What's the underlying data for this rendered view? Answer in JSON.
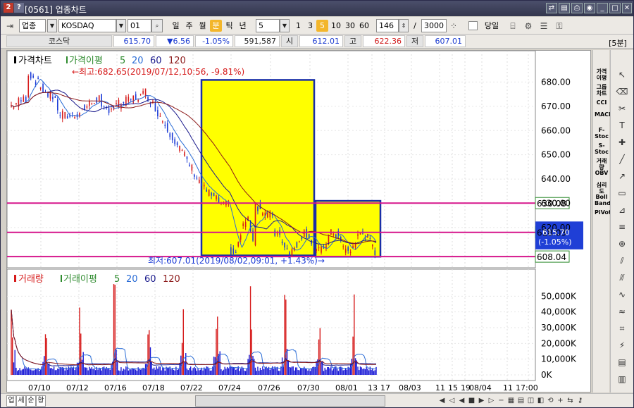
{
  "window": {
    "title": "[0561] 업종차트",
    "icons": [
      "2",
      "?"
    ]
  },
  "toolbar": {
    "type_select": "업종",
    "symbol_input": "KOSDAQ",
    "code_input": "01",
    "periods": [
      "일",
      "주",
      "월",
      "분",
      "틱",
      "년"
    ],
    "active_period": "분",
    "interval_value": "5",
    "interval_buttons": [
      "1",
      "3",
      "5",
      "10",
      "30",
      "60"
    ],
    "active_interval": "5",
    "count_value": "146",
    "slash": "/",
    "total_value": "3000",
    "same_day_label": "당일",
    "badge": "[5분]"
  },
  "quote": {
    "name": "코스닥",
    "price": "615.70",
    "change": "▼6.56",
    "change_pct": "-1.05%",
    "volume": "591,587",
    "open_label": "시",
    "open": "612.01",
    "high_label": "고",
    "high": "622.36",
    "low_label": "저",
    "low": "607.01"
  },
  "price_panel": {
    "legend_title": "가격차트",
    "legend_ma_title": "가격이평",
    "legend_periods": [
      "5",
      "20",
      "60",
      "120"
    ],
    "legend_colors": [
      "#2e8b2e",
      "#2a6cd6",
      "#1a1a8c",
      "#8c1a1a"
    ],
    "y_ticks": [
      "680.00",
      "670.00",
      "660.00",
      "650.00",
      "640.00",
      "630.00",
      "620.00"
    ],
    "high_note": "←최고:682.65(2019/07/12,10:56, -9.81%)",
    "low_note": "최저:607.01(2019/08/02,09:01, +1.43%)→",
    "line_labels": [
      "630.08",
      "618.03",
      "608.04"
    ],
    "current_label": "615.70",
    "current_pct": "(-1.05%)"
  },
  "volume_panel": {
    "legend_title": "거래량",
    "legend_ma_title": "거래이평",
    "legend_periods": [
      "5",
      "20",
      "60",
      "120"
    ],
    "y_ticks": [
      "50,000K",
      "40,000K",
      "30,000K",
      "20,000K",
      "10,000K",
      "0K"
    ]
  },
  "x_axis": {
    "labels": [
      "07/10",
      "07/12",
      "07/16",
      "07/18",
      "07/22",
      "07/24",
      "07/26",
      "07/30",
      "08/01",
      "13",
      "17",
      "08/03",
      "11",
      "15",
      "19",
      "08/04",
      "11",
      "17:00"
    ]
  },
  "right_indicators": [
    "가격이평",
    "그룹차트",
    "CCI",
    "MACD",
    "F-Stoc",
    "S-Stoc",
    "거래량",
    "OBV",
    "심리도",
    "Boll Band",
    "PiVot"
  ],
  "bottom_tabs": [
    "업",
    "세",
    "순",
    "황"
  ],
  "colors": {
    "highlight": "#ffff00",
    "highlight_border": "#1a2fa8",
    "support_line": "#d6158c",
    "current_box": "#1f3fd6",
    "volume_bar": "#1a1ad6"
  }
}
